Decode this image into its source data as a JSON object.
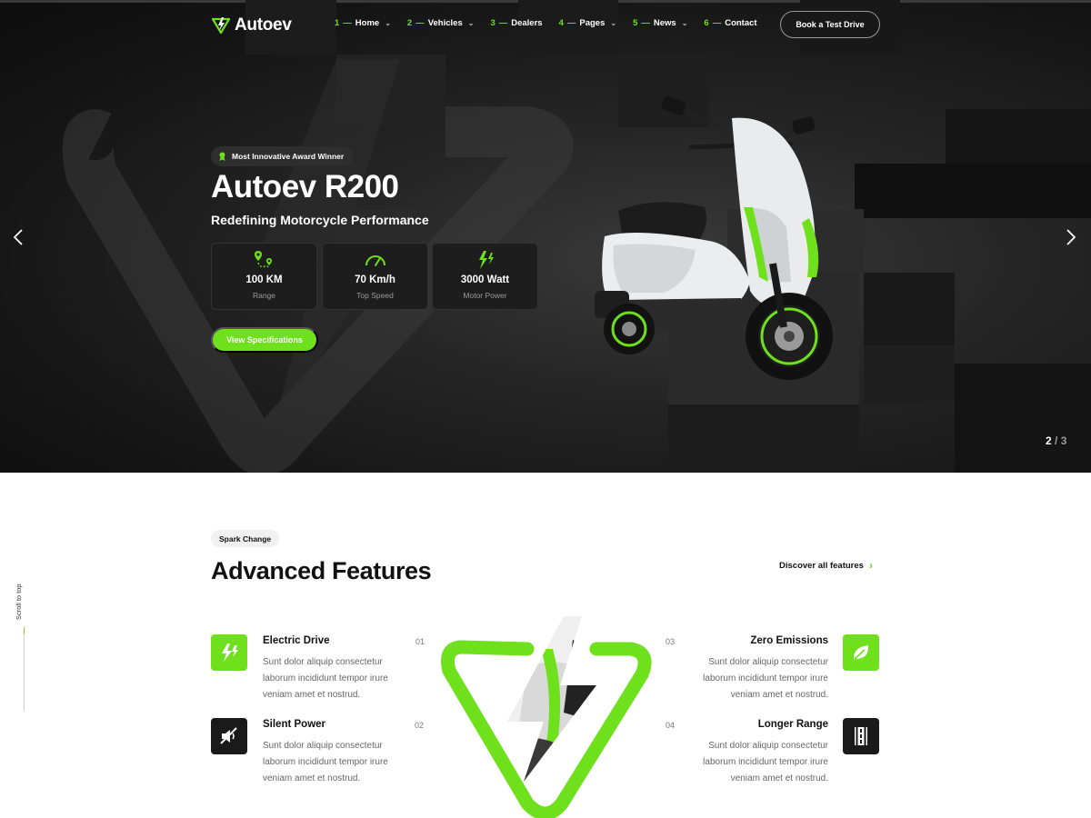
{
  "brand": {
    "name": "Autoev",
    "accent": "#6ee01c",
    "dark": "#111111"
  },
  "nav": {
    "items": [
      {
        "num": "1",
        "label": "Home",
        "dropdown": true
      },
      {
        "num": "2",
        "label": "Vehicles",
        "dropdown": true
      },
      {
        "num": "3",
        "label": "Dealers",
        "dropdown": false
      },
      {
        "num": "4",
        "label": "Pages",
        "dropdown": true
      },
      {
        "num": "5",
        "label": "News",
        "dropdown": true
      },
      {
        "num": "6",
        "label": "Contact",
        "dropdown": false
      }
    ],
    "cta": "Book a Test Drive"
  },
  "hero": {
    "badge": "Most Innovative Award Winner",
    "title": "Autoev R200",
    "subtitle": "Redefining Motorcycle Performance",
    "stats": [
      {
        "icon": "route-icon",
        "value": "100 KM",
        "label": "Range"
      },
      {
        "icon": "speedometer-icon",
        "value": "70 Km/h",
        "label": "Top Speed"
      },
      {
        "icon": "lightning-icon",
        "value": "3000 Watt",
        "label": "Motor Power"
      }
    ],
    "button": "View Specifications",
    "slide_current": "2",
    "slide_total": "3",
    "prev_icon": "chevron-left-icon",
    "next_icon": "chevron-right-icon"
  },
  "features": {
    "tag": "Spark Change",
    "title": "Advanced Features",
    "discover": "Discover all features",
    "scroll_label": "Scroll to top",
    "items": [
      {
        "num": "01",
        "name": "Electric Drive",
        "icon": "electric-drive-icon",
        "desc": "Sunt dolor aliquip consectetur laborum incididunt tempor irure veniam amet et nostrud."
      },
      {
        "num": "02",
        "name": "Silent Power",
        "icon": "mute-icon",
        "desc": "Sunt dolor aliquip consectetur laborum incididunt tempor irure veniam amet et nostrud."
      },
      {
        "num": "03",
        "name": "Zero Emissions",
        "icon": "leaf-icon",
        "desc": "Sunt dolor aliquip consectetur laborum incididunt tempor irure veniam amet et nostrud."
      },
      {
        "num": "04",
        "name": "Longer Range",
        "icon": "road-icon",
        "desc": "Sunt dolor aliquip consectetur laborum incididunt tempor irure veniam amet et nostrud."
      }
    ]
  }
}
